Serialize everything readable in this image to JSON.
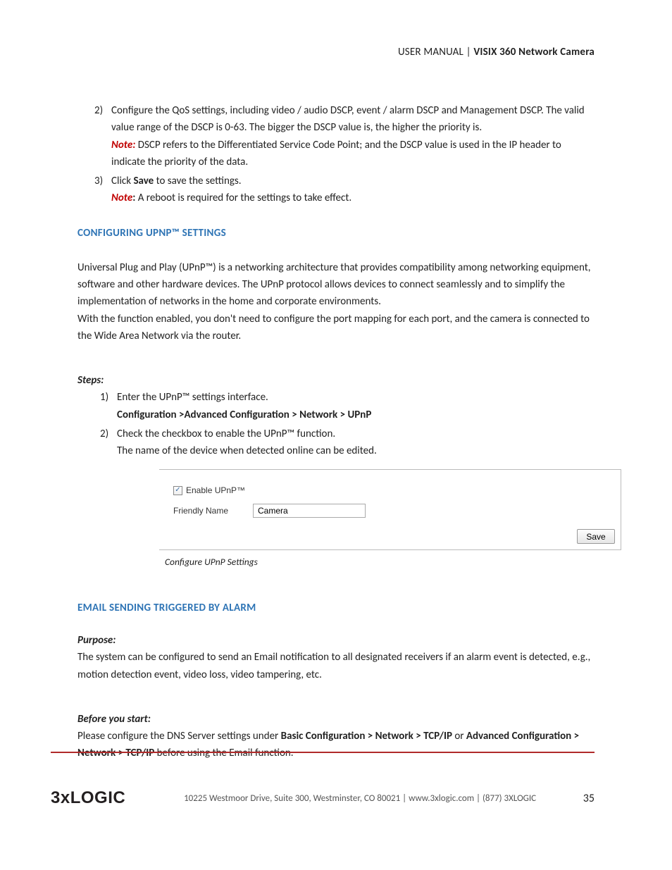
{
  "header": {
    "left": "USER MANUAL | ",
    "bold": "VISIX 360 Network Camera"
  },
  "qos": {
    "items": [
      {
        "num": "2)",
        "line1": "Configure the QoS settings, including video / audio DSCP, event / alarm DSCP and Management DSCP.",
        "line2": "The valid value range of the DSCP is 0-63. The bigger the DSCP value is, the higher the priority is.",
        "note_label": "Note:",
        "note_text": " DSCP refers to the Differentiated Service Code Point; and the DSCP value is used in the IP header to indicate the priority of the data."
      },
      {
        "num": "3)",
        "click": "Click ",
        "save_word": "Save",
        "rest": " to save the settings.",
        "note_label": "Note",
        "colon": ":",
        "note_text": " A reboot is required for the settings to take effect."
      }
    ]
  },
  "upnp": {
    "title": "CONFIGURING UPNP™ SETTINGS",
    "para": "Universal Plug and Play (UPnP™) is a networking architecture that provides compatibility among networking equipment, software and other hardware devices. The UPnP protocol allows devices to connect seamlessly and to simplify the implementation of networks in the home and corporate environments.",
    "para2": "With the function enabled, you don't need to configure the port mapping for each port, and the camera is connected to the Wide Area Network via the router.",
    "steps_label": "Steps:",
    "steps": [
      {
        "num": "1)",
        "text": "Enter the UPnP™ settings interface.",
        "path": "Configuration >Advanced Configuration > Network > UPnP"
      },
      {
        "num": "2)",
        "text": "Check the checkbox to enable the UPnP™ function.",
        "text2": "The name of the device when detected online can be edited."
      }
    ],
    "figure": {
      "checkbox_label": "Enable UPnP™",
      "friendly_label": "Friendly Name",
      "friendly_value": "Camera",
      "save_label": "Save",
      "caption": "Configure UPnP Settings"
    }
  },
  "email": {
    "title": "EMAIL SENDING TRIGGERED BY ALARM",
    "purpose_label": "Purpose:",
    "purpose_text": "The system can be configured to send an Email notification to all designated receivers if an alarm event is detected, e.g., motion detection event, video loss, video tampering, etc.",
    "before_label": "Before you start:",
    "before_pre": "Please configure the DNS Server settings under ",
    "before_path1": "Basic Configuration > Network > TCP/IP",
    "before_or": " or ",
    "before_path2": "Advanced Configuration > Network > TCP/IP",
    "before_post": " before using the Email function."
  },
  "footer": {
    "logo": "3xLOGIC",
    "text": "10225 Westmoor Drive, Suite 300, Westminster, CO 80021 | www.3xlogic.com | (877) 3XLOGIC",
    "page": "35"
  }
}
